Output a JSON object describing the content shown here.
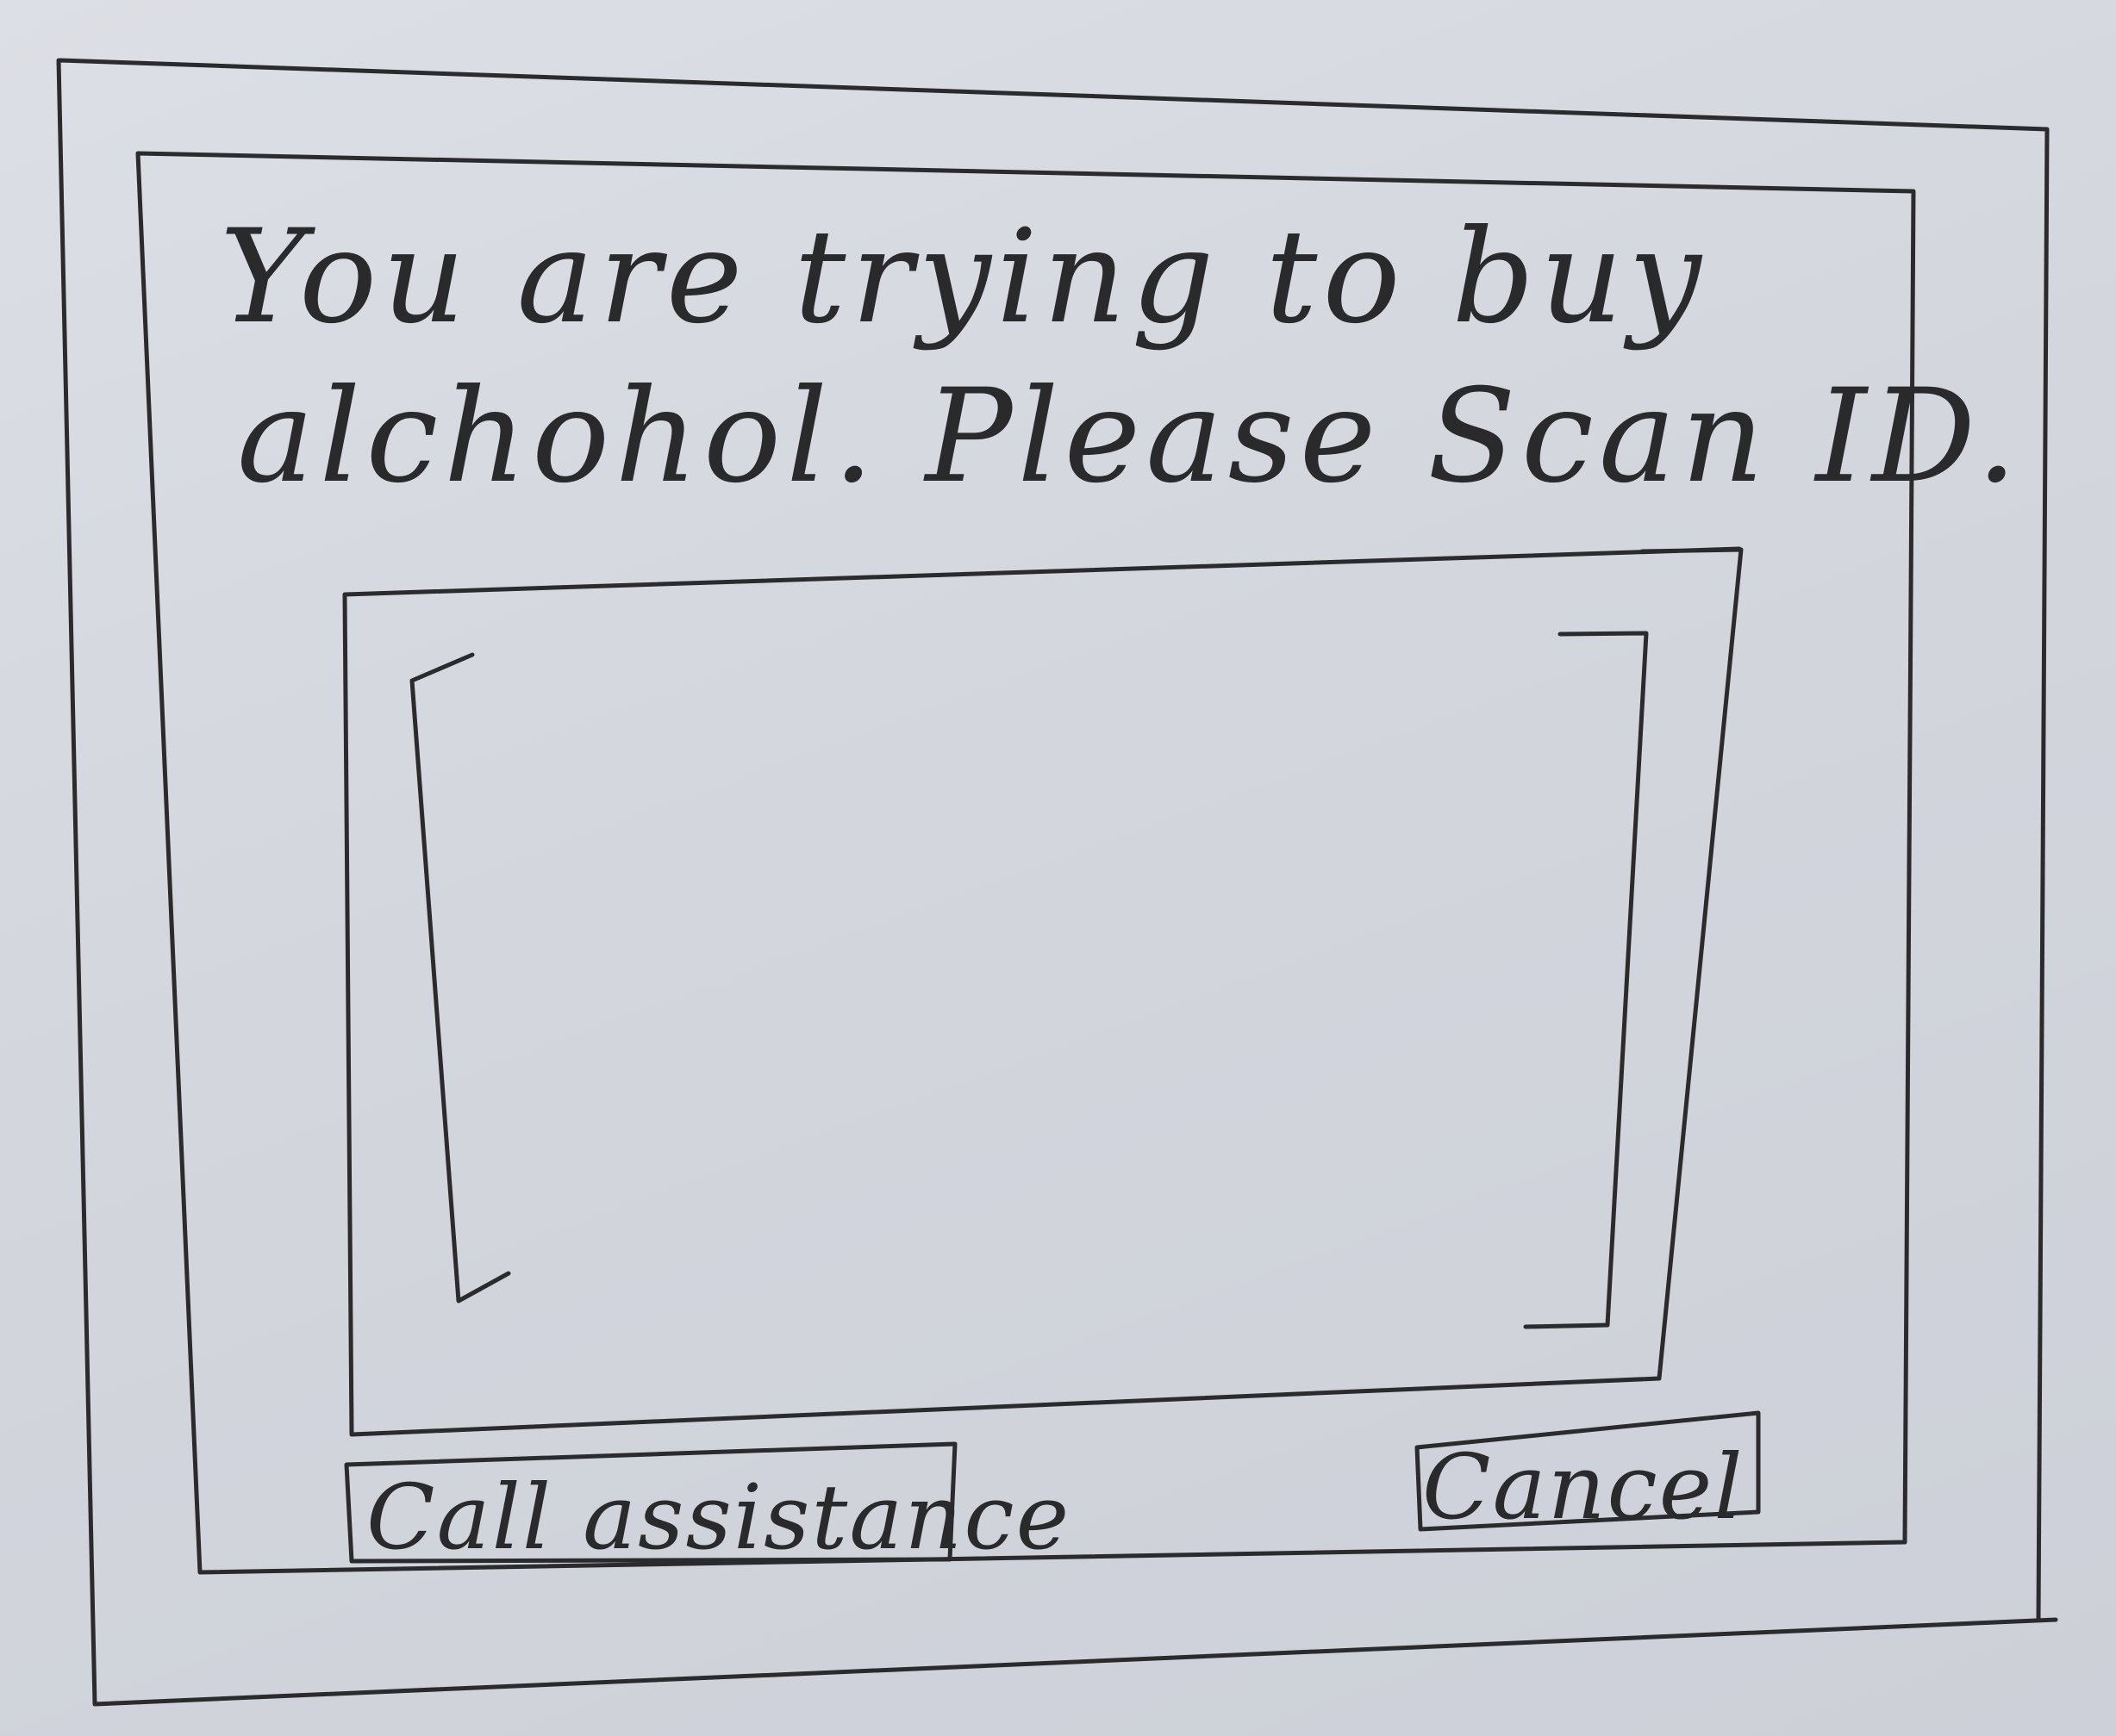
{
  "screen": {
    "prompt_line_1": "You are trying to buy",
    "prompt_line_2": "alchohol. Please Scan ID."
  },
  "actions": {
    "call_assistance_label": "Call assistance",
    "cancel_label": "Cancel"
  }
}
